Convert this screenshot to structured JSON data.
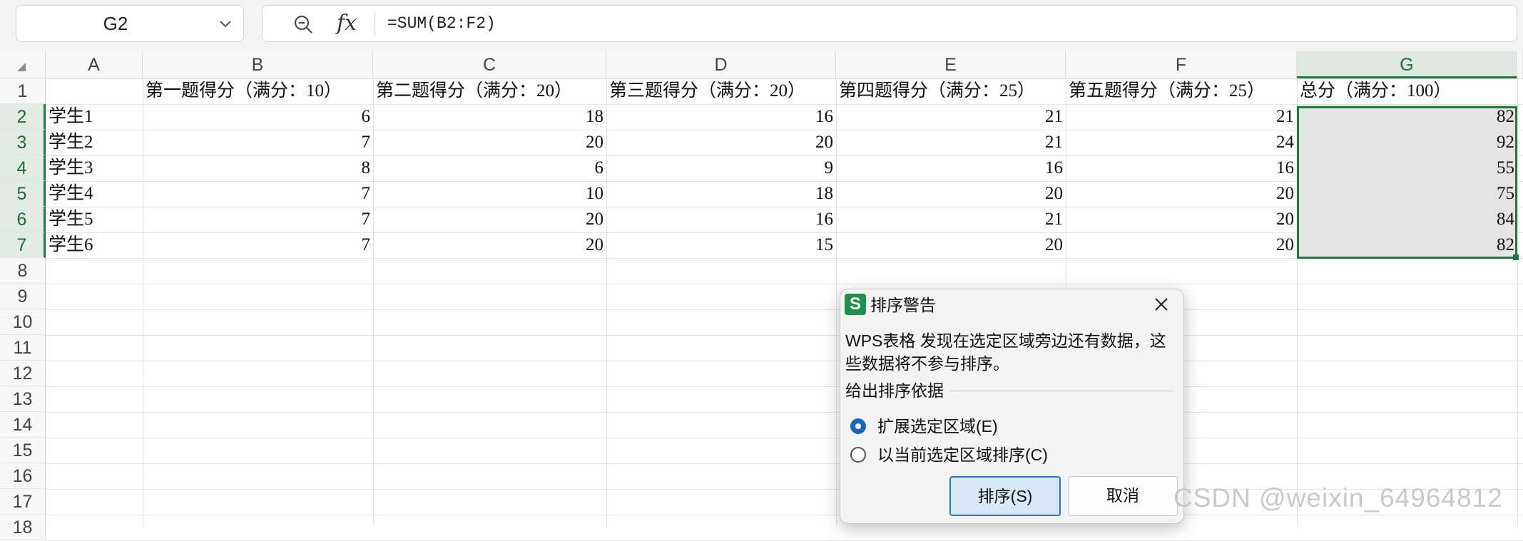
{
  "formula_bar": {
    "name_box": "G2",
    "fx_label": "fx",
    "formula": "=SUM(B2:F2)"
  },
  "columns": [
    "A",
    "B",
    "C",
    "D",
    "E",
    "F",
    "G"
  ],
  "active_column": "G",
  "rows": [
    "1",
    "2",
    "3",
    "4",
    "5",
    "6",
    "7",
    "8",
    "9",
    "10",
    "11",
    "12",
    "13",
    "14",
    "15",
    "16",
    "17",
    "18"
  ],
  "active_rows": [
    "2",
    "3",
    "4",
    "5",
    "6",
    "7"
  ],
  "sheet": {
    "header": [
      "",
      "第一题得分（满分：10）",
      "第二题得分（满分：20）",
      "第三题得分（满分：20）",
      "第四题得分（满分：25）",
      "第五题得分（满分：25）",
      "总分（满分：100）"
    ],
    "data": [
      [
        "学生1",
        "6",
        "18",
        "16",
        "21",
        "21",
        "82"
      ],
      [
        "学生2",
        "7",
        "20",
        "20",
        "21",
        "24",
        "92"
      ],
      [
        "学生3",
        "8",
        "6",
        "9",
        "16",
        "16",
        "55"
      ],
      [
        "学生4",
        "7",
        "10",
        "18",
        "20",
        "20",
        "75"
      ],
      [
        "学生5",
        "7",
        "20",
        "16",
        "21",
        "20",
        "84"
      ],
      [
        "学生6",
        "7",
        "20",
        "15",
        "20",
        "20",
        "82"
      ]
    ]
  },
  "dialog": {
    "app_icon": "S",
    "title": "排序警告",
    "message": "WPS表格 发现在选定区域旁边还有数据，这些数据将不参与排序。",
    "group_label": "给出排序依据",
    "options": [
      {
        "label": "扩展选定区域(E)",
        "checked": true
      },
      {
        "label": "以当前选定区域排序(C)",
        "checked": false
      }
    ],
    "sort_button": "排序(S)",
    "cancel_button": "取消"
  },
  "watermark": "CSDN @weixin_64964812",
  "colors": {
    "accent_green": "#1f7a3d",
    "dialog_button_blue": "#2a76c4",
    "app_icon_green": "#1f8f49"
  }
}
